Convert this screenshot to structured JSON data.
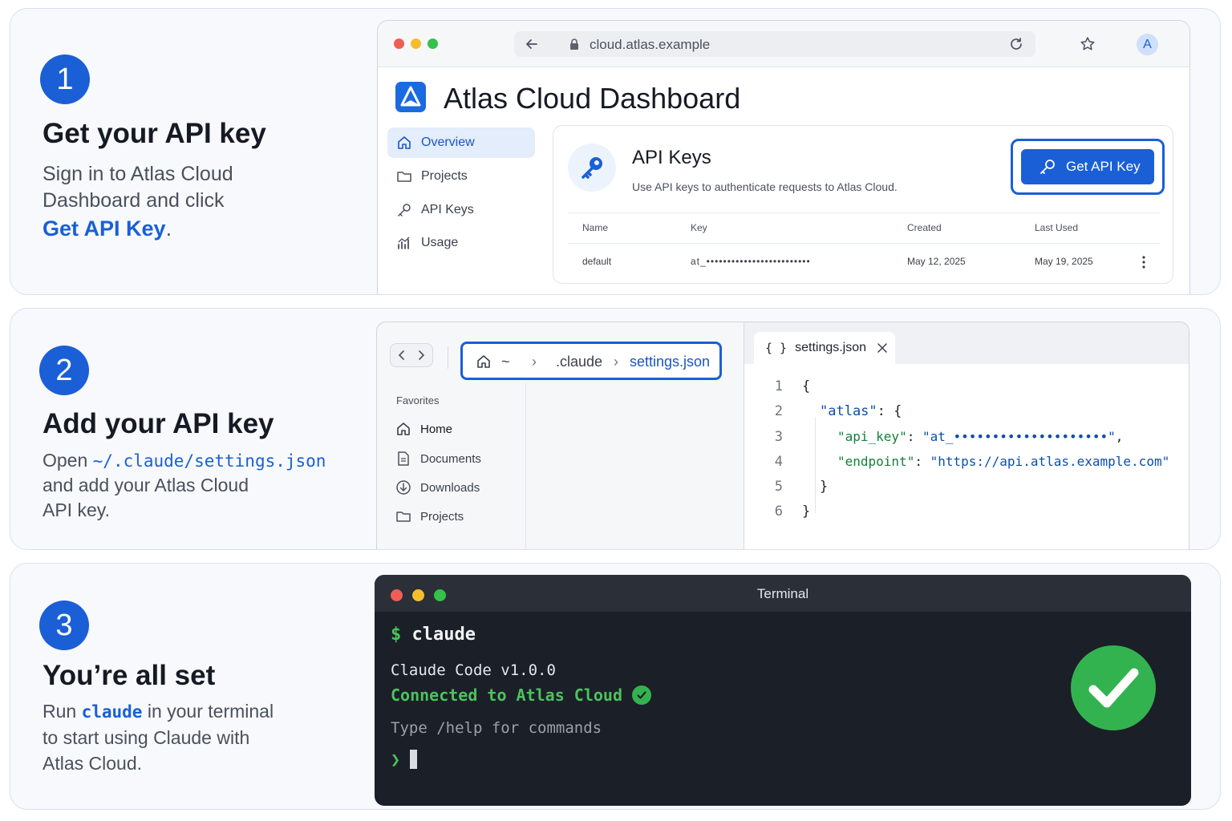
{
  "steps": [
    {
      "number": "1",
      "title": "Get your API key",
      "desc_line1": "Sign in to Atlas Cloud",
      "desc_line2": "Dashboard and click",
      "desc_highlight": "Get API Key",
      "desc_end": "."
    },
    {
      "number": "2",
      "title": "Add your API key",
      "desc_open": "Open",
      "desc_path": "~/.claude/settings.json",
      "desc_line2": "and add your Atlas Cloud",
      "desc_line3": "API key."
    },
    {
      "number": "3",
      "title": "You’re all set",
      "desc_run": "Run",
      "desc_cmd": "claude",
      "desc_rest": "in your terminal",
      "desc_line2": "to start using Claude with",
      "desc_line3": "Atlas Cloud."
    }
  ],
  "browser": {
    "url": "cloud.atlas.example",
    "avatar": "A",
    "dashboard_title": "Atlas Cloud Dashboard",
    "nav": [
      {
        "label": "Overview",
        "icon": "home-icon",
        "active": true
      },
      {
        "label": "Projects",
        "icon": "folder-icon"
      },
      {
        "label": "API Keys",
        "icon": "key-icon"
      },
      {
        "label": "Usage",
        "icon": "chart-icon"
      }
    ],
    "card": {
      "title": "API Keys",
      "subtitle": "Use API keys to authenticate requests to Atlas Cloud.",
      "button": "Get API Key",
      "columns": [
        "Name",
        "Key",
        "Created",
        "Last Used"
      ],
      "rows": [
        {
          "name": "default",
          "key": "at_•••••••••••••••••••••••••",
          "created": "May 12, 2025",
          "last_used": "May 19, 2025"
        }
      ]
    }
  },
  "explorer": {
    "crumbs": [
      "~",
      ".claude",
      "settings.json"
    ],
    "favorites_label": "Favorites",
    "favorites": [
      {
        "label": "Home",
        "icon": "home-icon",
        "active": true
      },
      {
        "label": "Documents",
        "icon": "document-icon"
      },
      {
        "label": "Downloads",
        "icon": "download-icon"
      },
      {
        "label": "Projects",
        "icon": "folder-icon"
      }
    ]
  },
  "editor": {
    "tab_icon": "{ }",
    "tab_label": "settings.json",
    "lines": [
      {
        "n": "1",
        "text": "{"
      },
      {
        "n": "2",
        "key": "\"atlas\"",
        "after": ": {"
      },
      {
        "n": "3",
        "key": "\"api_key\"",
        "sep": ": ",
        "value": "\"at_••••••••••••••••••••\"",
        "after": ","
      },
      {
        "n": "4",
        "key": "\"endpoint\"",
        "sep": ": ",
        "value": "\"https://api.atlas.example.com\""
      },
      {
        "n": "5",
        "text": "}"
      },
      {
        "n": "6",
        "text": "}"
      }
    ]
  },
  "terminal": {
    "title": "Terminal",
    "prompt": "$",
    "command": "claude",
    "version": "Claude Code v1.0.0",
    "connected": "Connected to Atlas Cloud",
    "help": "Type /help for commands",
    "input_prompt": "❯"
  },
  "colors": {
    "accent": "#1a5fd6",
    "success": "#33b34f",
    "terminal_bg": "#1b1f27",
    "terminal_green": "#4cc25e"
  }
}
